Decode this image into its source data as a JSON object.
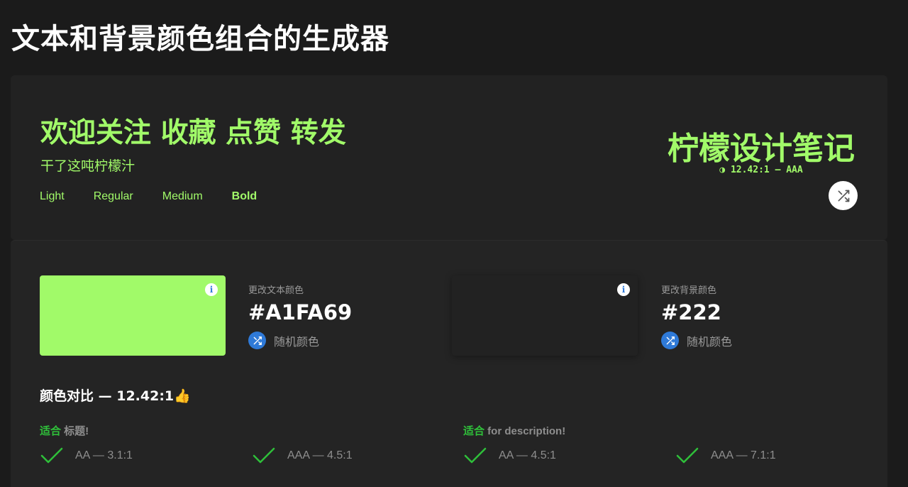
{
  "title": "文本和背景颜色组合的生成器",
  "colors": {
    "text": "#A1FA69",
    "background": "#222222",
    "accent": "#2F7AD8",
    "pass": "#2FBF3A"
  },
  "preview": {
    "heading": "欢迎关注 收藏 点赞 转发",
    "subheading": "干了这吨柠檬汁",
    "weights": [
      "Light",
      "Regular",
      "Medium",
      "Bold"
    ],
    "brand": "柠檬设计笔记",
    "ratio_text": "◑ 12.42:1 – AAA",
    "shuffle_icon": "shuffle-icon"
  },
  "text_color": {
    "label": "更改文本颜色",
    "hex": "#A1FA69",
    "random_label": "随机颜色",
    "info_icon": "info-icon"
  },
  "background_color": {
    "label": "更改背景颜色",
    "hex": "#222",
    "random_label": "随机颜色",
    "info_icon": "info-icon"
  },
  "contrast": {
    "title": "颜色对比 — 12.42:1👍",
    "groups": [
      {
        "suitable": "适合",
        "purpose": " 标题!",
        "checks": [
          "AA — 3.1:1",
          "AAA — 4.5:1"
        ]
      },
      {
        "suitable": "适合",
        "purpose": " for description!",
        "checks": [
          "AA — 4.5:1",
          "AAA — 7.1:1"
        ]
      }
    ]
  }
}
